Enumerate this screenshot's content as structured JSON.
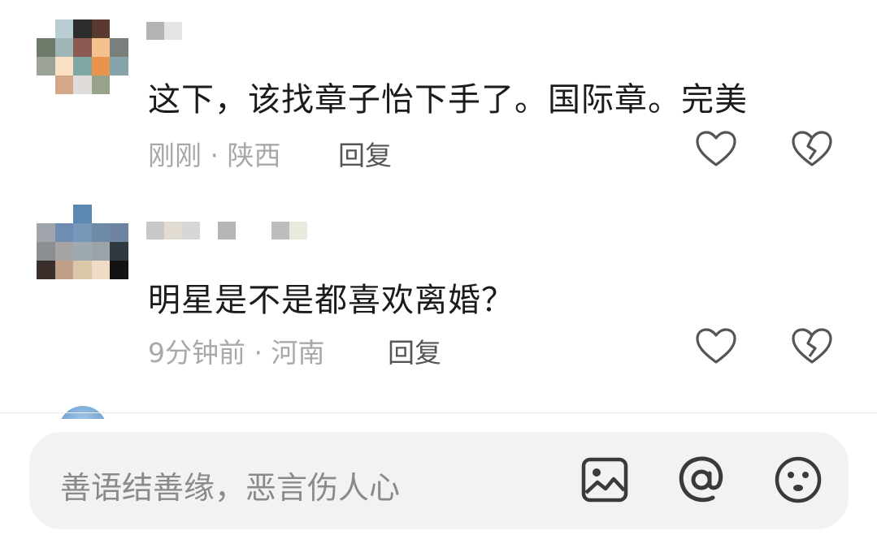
{
  "comments": [
    {
      "text": "这下，该找章子怡下手了。国际章。完美",
      "time": "刚刚",
      "location": "陕西",
      "separator": " · ",
      "reply_label": "回复",
      "like_icon": "heart-outline-icon",
      "dislike_icon": "broken-heart-icon",
      "avatar_colors": [
        "#ffffff",
        "#b8ced3",
        "#2c2c2c",
        "#5a3a2e",
        "#ffffff",
        "#6d7a6a",
        "#9eb7b6",
        "#8b5a52",
        "#f4c18f",
        "#7a7f7c",
        "#9ba496",
        "#f9dfc4",
        "#80a6a4",
        "#e9934c",
        "#86a4aa",
        "#ffffff",
        "#d3a888",
        "#e0dcd9",
        "#99a38c",
        "#ffffff"
      ],
      "name_colors": [
        "#b3b3b3",
        "#e4e4e4"
      ]
    },
    {
      "text": "明星是不是都喜欢离婚？",
      "time": "9分钟前",
      "location": "河南",
      "separator": " · ",
      "reply_label": "回复",
      "like_icon": "heart-outline-icon",
      "dislike_icon": "broken-heart-icon",
      "avatar_colors": [
        "#ffffff",
        "#ffffff",
        "#5b88b1",
        "#ffffff",
        "#ffffff",
        "#a0a5ab",
        "#6e8db0",
        "#7896b8",
        "#6f8aa4",
        "#6f84a0",
        "#8b8f92",
        "#a6a5a4",
        "#9fa9b0",
        "#9aa3a8",
        "#2e3940",
        "#3b2f2b",
        "#c1a089",
        "#dcc6a8",
        "#eedcc4",
        "#131313"
      ],
      "name_colors": [
        "#c8c8c8",
        "#e2dcd3",
        "#d6d6d6",
        "#ffffff",
        "#b6b6b6",
        "#ffffff",
        "#ffffff",
        "#bdbdbd",
        "#e7eadd"
      ]
    }
  ],
  "input": {
    "placeholder": "善语结善缘，恶言伤人心",
    "icons": [
      "image-icon",
      "at-icon",
      "emoji-icon"
    ]
  },
  "colors": {
    "text": "#1b1b1b",
    "meta": "#a8a8a8",
    "input_bg": "#f2f2f2",
    "icon": "#3a3a3a"
  }
}
